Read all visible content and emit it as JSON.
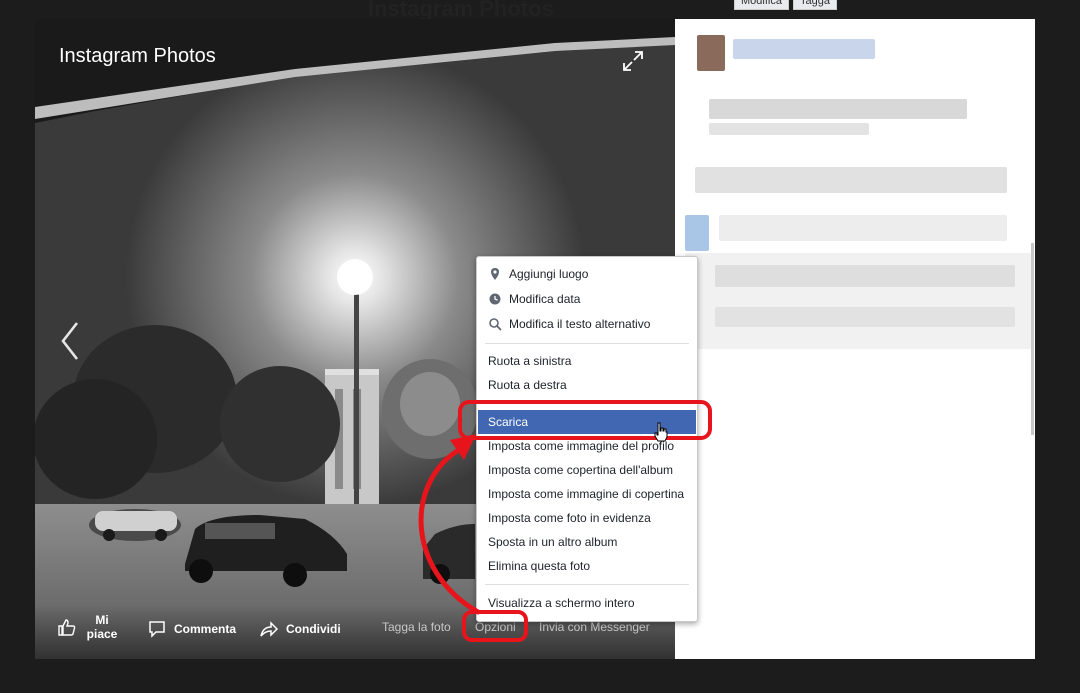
{
  "background": {
    "page_title": "Instagram Photos",
    "buttons": [
      "Modifica",
      "Tagga"
    ]
  },
  "viewer": {
    "title": "Instagram Photos",
    "icons": {
      "expand": "expand-icon",
      "previous": "chevron-left-icon"
    }
  },
  "actions": {
    "like": "Mi piace",
    "comment": "Commenta",
    "share": "Condividi",
    "tag": "Tagga la foto",
    "options": "Opzioni",
    "messenger": "Invia con Messenger"
  },
  "menu": {
    "add_place": "Aggiungi luogo",
    "edit_date": "Modifica data",
    "edit_alt_text": "Modifica il testo alternativo",
    "rotate_left": "Ruota a sinistra",
    "rotate_right": "Ruota a destra",
    "download": "Scarica",
    "set_profile": "Imposta come immagine del profilo",
    "set_album_cover": "Imposta come copertina dell'album",
    "set_cover": "Imposta come immagine di copertina",
    "set_featured": "Imposta come foto in evidenza",
    "move_album": "Sposta in un altro album",
    "delete_photo": "Elimina questa foto",
    "fullscreen": "Visualizza a schermo intero"
  },
  "colors": {
    "menu_highlight": "#4267b2",
    "annotation": "#e8141c",
    "background": "#1c1c1c"
  }
}
